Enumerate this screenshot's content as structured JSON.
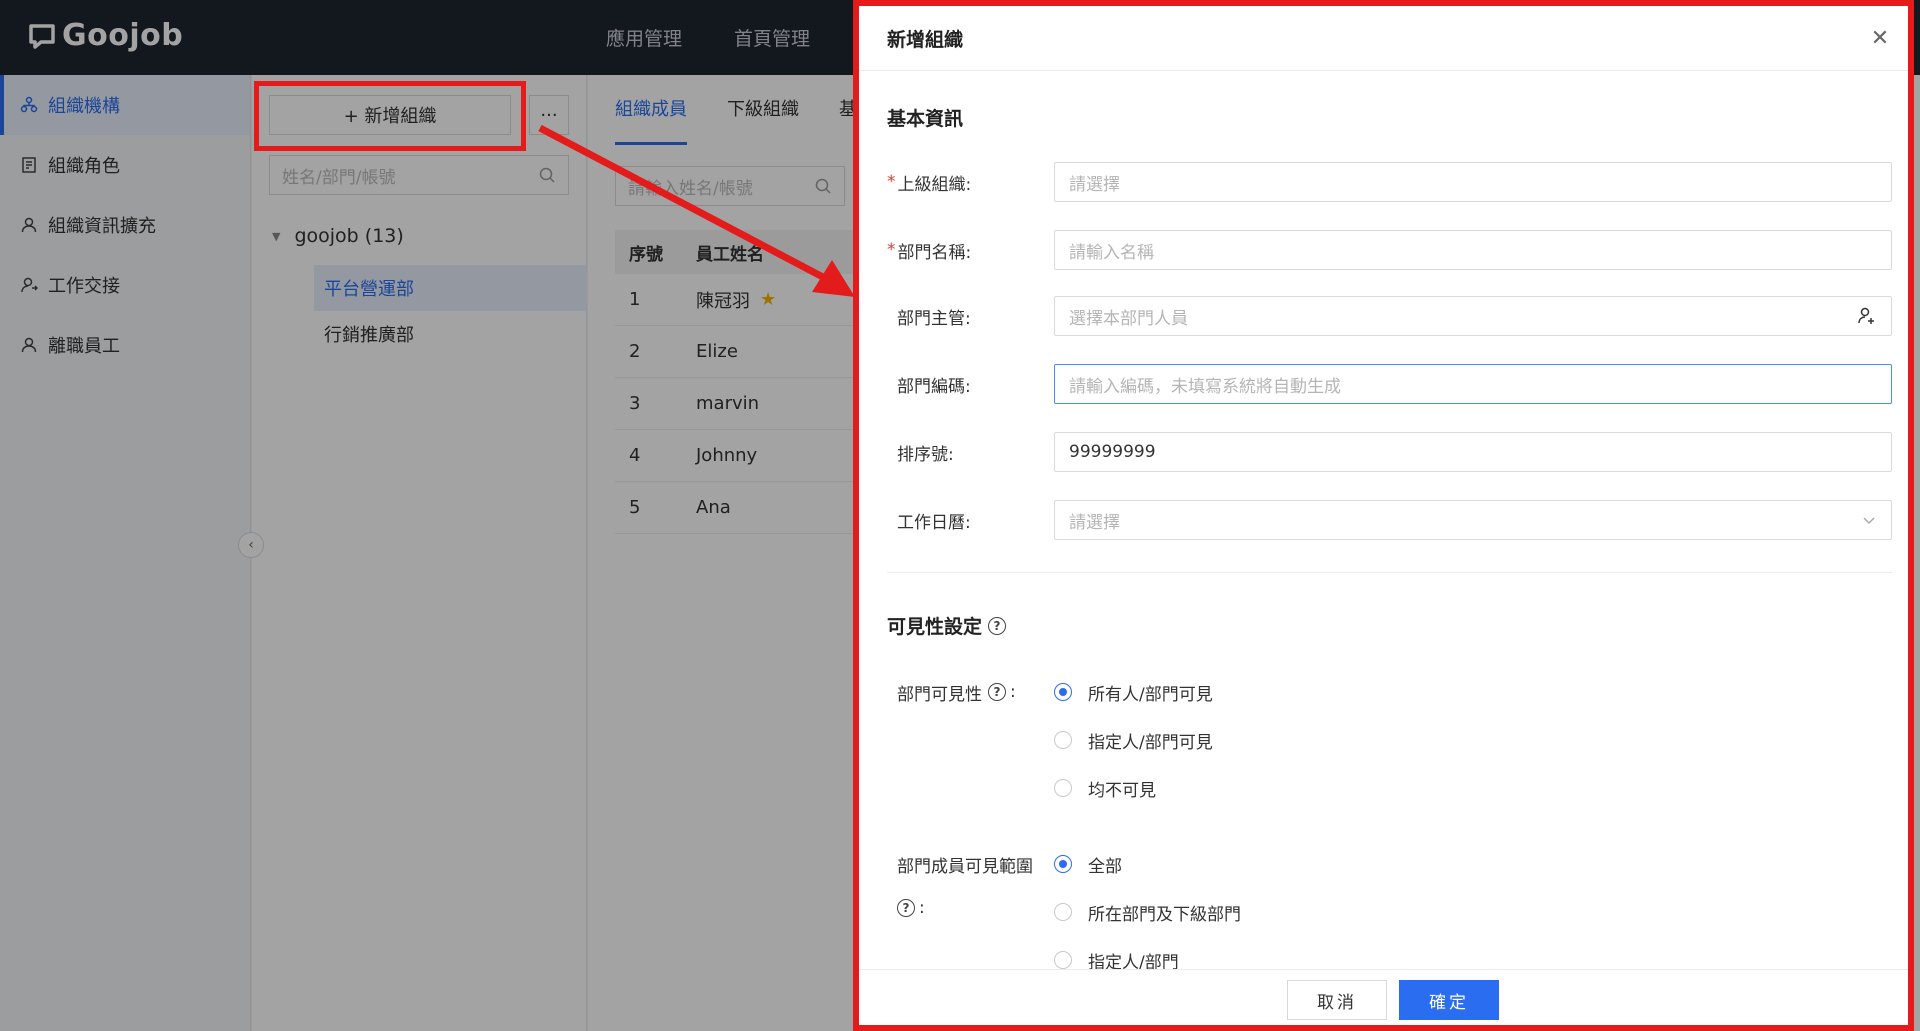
{
  "app": {
    "logo_text": "Goojob"
  },
  "topnav": {
    "items": [
      "應用管理",
      "首頁管理"
    ]
  },
  "sidebar": {
    "items": [
      {
        "label": "組織機構",
        "icon": "org-icon"
      },
      {
        "label": "組織角色",
        "icon": "role-icon"
      },
      {
        "label": "組織資訊擴充",
        "icon": "user-icon"
      },
      {
        "label": "工作交接",
        "icon": "handover-icon"
      },
      {
        "label": "離職員工",
        "icon": "user-icon"
      }
    ]
  },
  "tree": {
    "add_button": "+ 新增組織",
    "more_button": "···",
    "search_placeholder": "姓名/部門/帳號",
    "root_label": "goojob (13)",
    "nodes": [
      "平台營運部",
      "行銷推廣部"
    ]
  },
  "main": {
    "tabs": [
      "組織成員",
      "下級組織",
      "基"
    ],
    "search_placeholder": "請輸入姓名/帳號",
    "table": {
      "headers": [
        "序號",
        "員工姓名"
      ],
      "rows": [
        {
          "no": "1",
          "name": "陳冠羽"
        },
        {
          "no": "2",
          "name": "Elize"
        },
        {
          "no": "3",
          "name": "marvin"
        },
        {
          "no": "4",
          "name": "Johnny"
        },
        {
          "no": "5",
          "name": "Ana"
        }
      ]
    }
  },
  "modal": {
    "title": "新增組織",
    "basic_section": "基本資訊",
    "fields": {
      "parent": {
        "label": "上級組織:",
        "placeholder": "請選擇"
      },
      "name": {
        "label": "部門名稱:",
        "placeholder": "請輸入名稱"
      },
      "manager": {
        "label": "部門主管:",
        "placeholder": "選擇本部門人員"
      },
      "code": {
        "label": "部門編碼:",
        "placeholder": "請輸入編碼，未填寫系統將自動生成"
      },
      "order": {
        "label": "排序號:",
        "value": "99999999"
      },
      "calendar": {
        "label": "工作日曆:",
        "placeholder": "請選擇"
      }
    },
    "visibility_section": "可見性設定",
    "dept_visibility": {
      "label": "部門可見性",
      "options": [
        "所有人/部門可見",
        "指定人/部門可見",
        "均不可見"
      ],
      "selected": 0
    },
    "member_visibility": {
      "label": "部門成員可見範圍",
      "options": [
        "全部",
        "所在部門及下級部門",
        "指定人/部門"
      ],
      "selected": 0
    },
    "cancel": "取消",
    "ok": "確定"
  },
  "colors": {
    "accent": "#2b6df0",
    "highlight": "#e41b1b",
    "header_bg": "#1f2430"
  }
}
